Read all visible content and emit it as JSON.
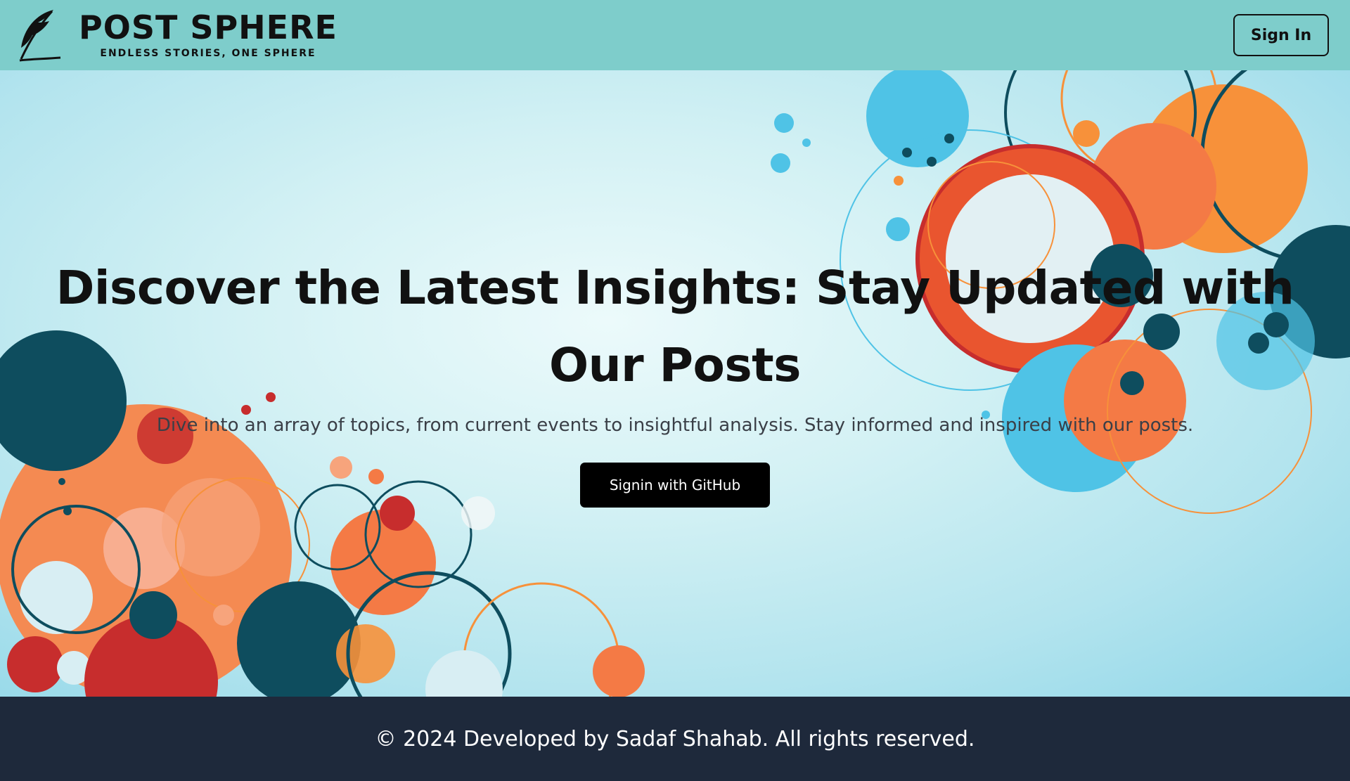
{
  "navbar": {
    "brand_name": "POST SPHERE",
    "tagline": "ENDLESS STORIES, ONE SPHERE",
    "logo_icon": "feather-quill-icon",
    "signin_label": "Sign In"
  },
  "hero": {
    "title": "Discover the Latest Insights: Stay Updated with Our Posts",
    "subtitle": "Dive into an array of topics, from current events to insightful analysis. Stay informed and inspired with our posts.",
    "cta_label": "Signin with GitHub"
  },
  "footer": {
    "text": "© 2024 Developed by Sadaf Shahab. All rights reserved."
  },
  "colors": {
    "navbar_bg": "#7ecdcb",
    "footer_bg": "#1e293b",
    "accent_orange": "#f7913a",
    "accent_red": "#e9552f",
    "accent_teal": "#0e4d5e",
    "accent_blue": "#4fc3e6"
  }
}
